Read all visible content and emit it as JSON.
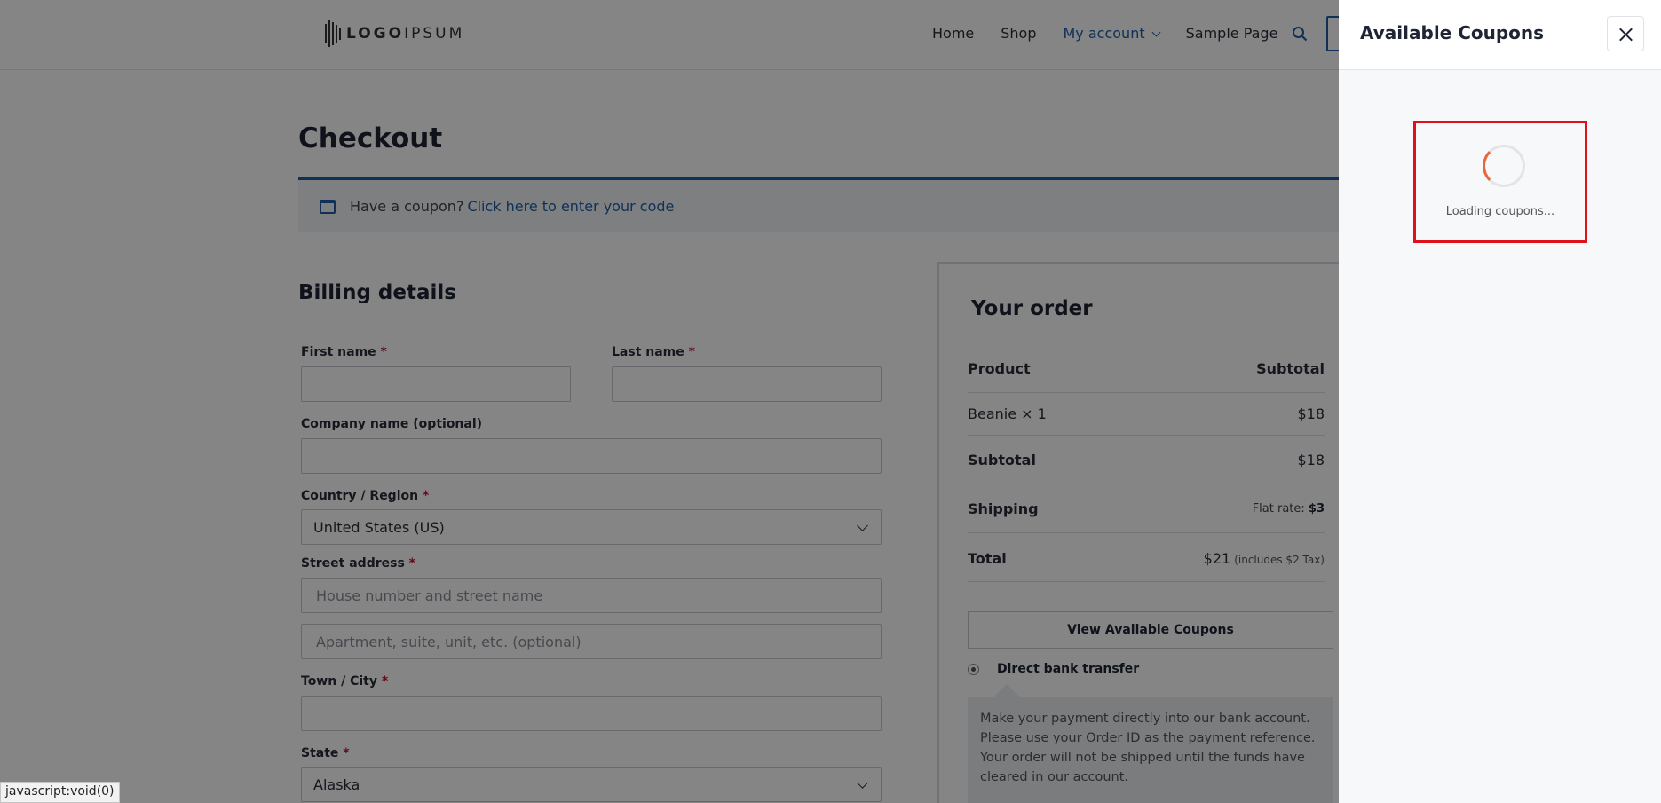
{
  "header": {
    "logo_bold": "LOGO",
    "logo_light": "IPSUM",
    "nav": [
      {
        "label": "Home"
      },
      {
        "label": "Shop"
      },
      {
        "label": "My account"
      },
      {
        "label": "Sample Page"
      }
    ]
  },
  "page": {
    "title": "Checkout",
    "coupon_prompt": "Have a coupon?",
    "coupon_link": "Click here to enter your code"
  },
  "billing": {
    "title": "Billing details",
    "first_name_label": "First name",
    "last_name_label": "Last name",
    "company_label": "Company name (optional)",
    "country_label": "Country / Region",
    "country_value": "United States (US)",
    "street_label": "Street address",
    "street_placeholder": "House number and street name",
    "street2_placeholder": "Apartment, suite, unit, etc. (optional)",
    "city_label": "Town / City",
    "state_label": "State",
    "state_value": "Alaska",
    "required_mark": "*"
  },
  "order": {
    "title": "Your order",
    "col_product": "Product",
    "col_subtotal": "Subtotal",
    "item_name": "Beanie × 1",
    "item_price": "$18",
    "subtotal_label": "Subtotal",
    "subtotal_value": "$18",
    "shipping_label": "Shipping",
    "shipping_method": "Flat rate:",
    "shipping_value": "$3",
    "total_label": "Total",
    "total_value": "$21",
    "total_tax": "(includes $2 Tax)",
    "coupons_button": "View Available Coupons",
    "payment_method": "Direct bank transfer",
    "payment_description": "Make your payment directly into our bank account. Please use your Order ID as the payment reference. Your order will not be shipped until the funds have cleared in our account."
  },
  "drawer": {
    "title": "Available Coupons",
    "loading_text": "Loading coupons..."
  },
  "status_bar": {
    "text": "javascript:void(0)"
  },
  "colors": {
    "accent": "#1f5ea8",
    "required": "#c8102e",
    "highlight_border": "#e0101a",
    "spinner": "#e8683a"
  }
}
